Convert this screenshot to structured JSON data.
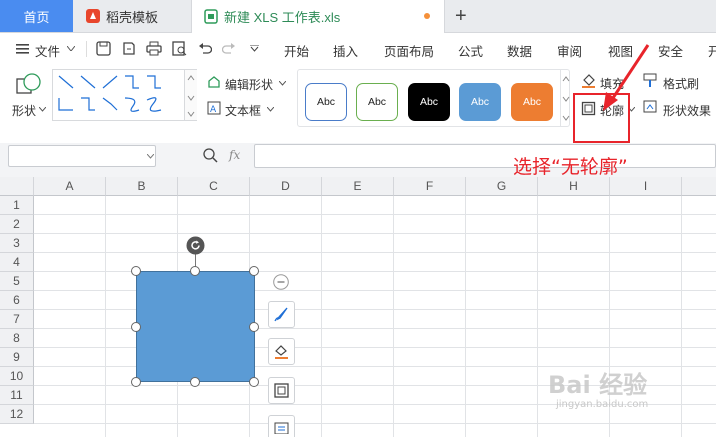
{
  "tabs": {
    "home": "首页",
    "template": "稻壳模板",
    "file": "新建 XLS 工作表.xls",
    "new_tab": "+"
  },
  "menu": {
    "file": "文件",
    "items": [
      "开始",
      "插入",
      "页面布局",
      "公式",
      "数据",
      "审阅",
      "视图",
      "安全",
      "开"
    ]
  },
  "ribbon": {
    "shape_label": "形状",
    "edit_shape": "编辑形状",
    "textbox": "文本框",
    "style_samples": [
      "Abc",
      "Abc",
      "Abc",
      "Abc",
      "Abc"
    ],
    "fill": "填充",
    "outline": "轮廓",
    "format_painter": "格式刷",
    "shape_effects": "形状效果"
  },
  "formula_bar": {
    "zoom_icon": "magnifier-icon",
    "fx": "fx"
  },
  "grid": {
    "columns": [
      "A",
      "B",
      "C",
      "D",
      "E",
      "F",
      "G",
      "H",
      "I"
    ],
    "rows": [
      "1",
      "2",
      "3",
      "4",
      "5",
      "6",
      "7",
      "8",
      "9",
      "10",
      "11",
      "12"
    ]
  },
  "shape": {
    "fill_color": "#5b9bd5"
  },
  "annotation": "选择“无轮廓”",
  "watermark": {
    "main": "Bai 经验",
    "sub": "jingyan.baidu.com"
  },
  "colors": {
    "accent": "#4a8cf0",
    "annotation": "#e8242b",
    "file_tab_text": "#2e8b57"
  }
}
